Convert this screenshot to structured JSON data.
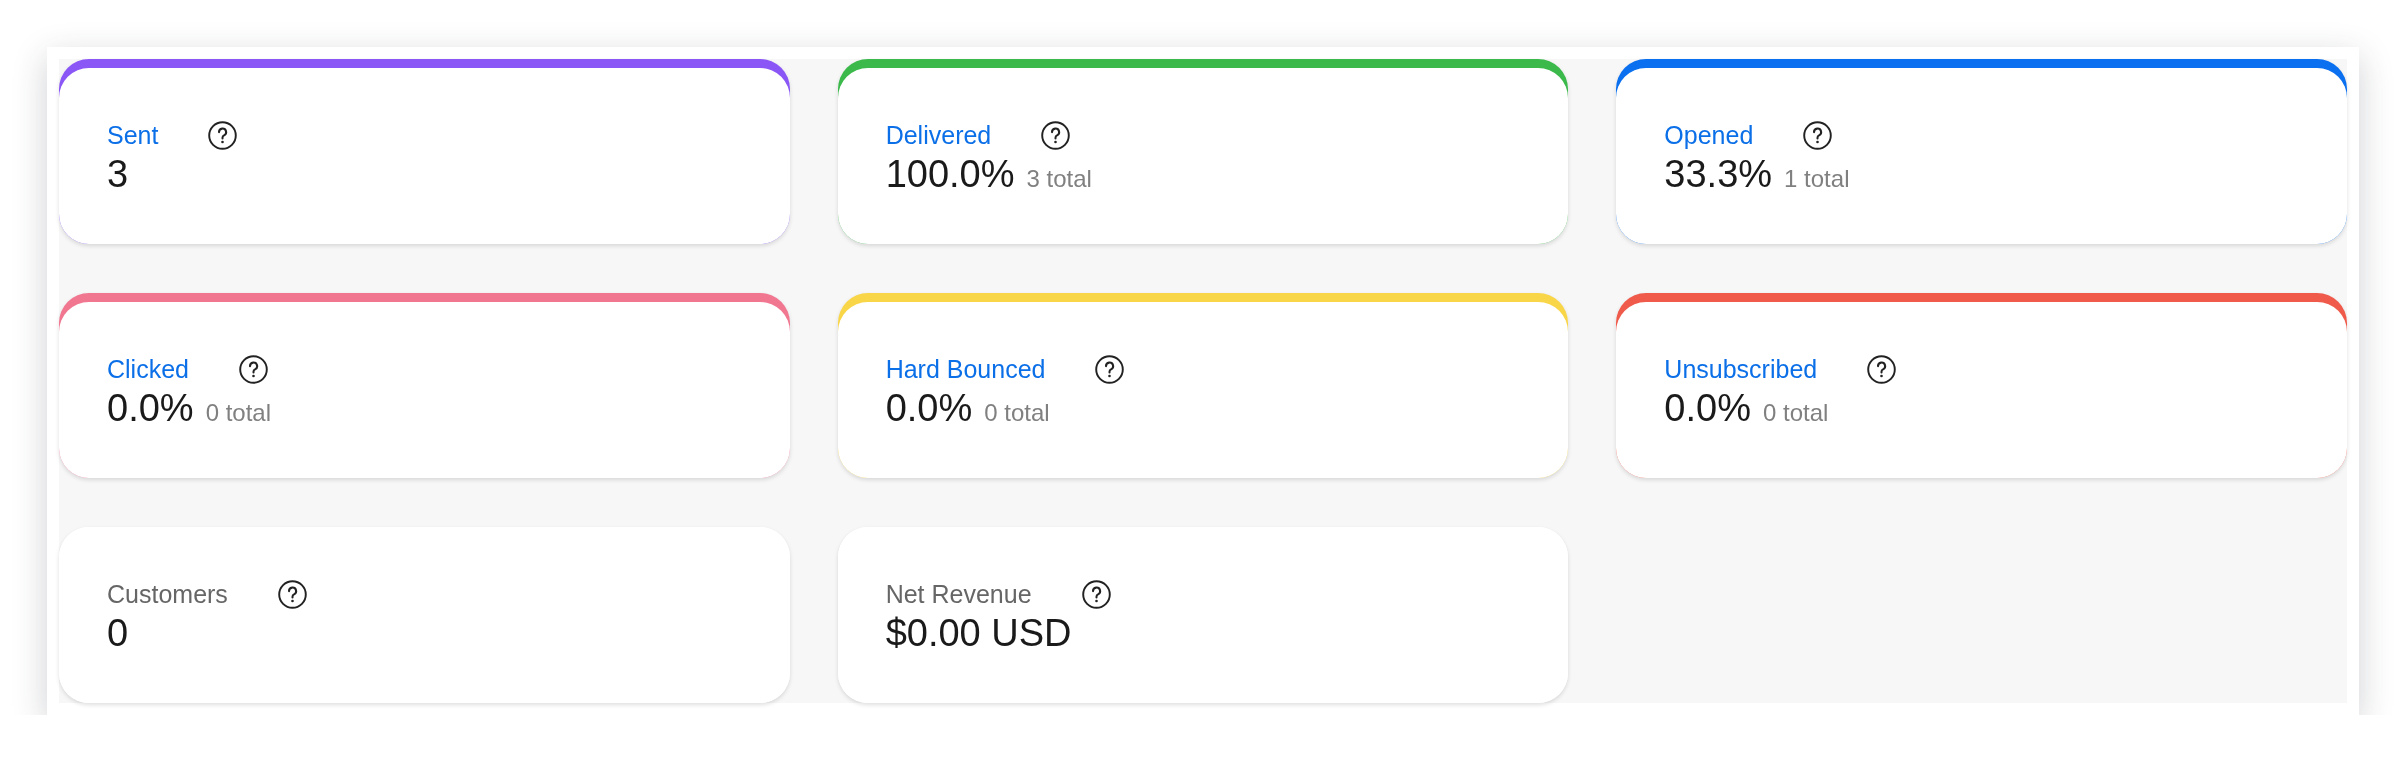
{
  "cards": [
    {
      "kind": "linked",
      "color": "#8a56f6",
      "label": "Sent",
      "value": "3"
    },
    {
      "kind": "linked",
      "color": "#3bb94b",
      "label": "Delivered",
      "value": "100.0%",
      "total": "3 total"
    },
    {
      "kind": "linked",
      "color": "#0a70ef",
      "label": "Opened",
      "value": "33.3%",
      "total": "1 total"
    },
    {
      "kind": "linked",
      "color": "#f17690",
      "label": "Clicked",
      "value": "0.0%",
      "total": "0 total"
    },
    {
      "kind": "linked",
      "color": "#f9d548",
      "label": "Hard Bounced",
      "value": "0.0%",
      "total": "0 total"
    },
    {
      "kind": "linked",
      "color": "#ef5a4b",
      "label": "Unsubscribed",
      "value": "0.0%",
      "total": "0 total"
    },
    {
      "kind": "plain",
      "label": "Customers",
      "value": "0"
    },
    {
      "kind": "plain",
      "label": "Net Revenue",
      "value": "$0.00 USD"
    }
  ]
}
